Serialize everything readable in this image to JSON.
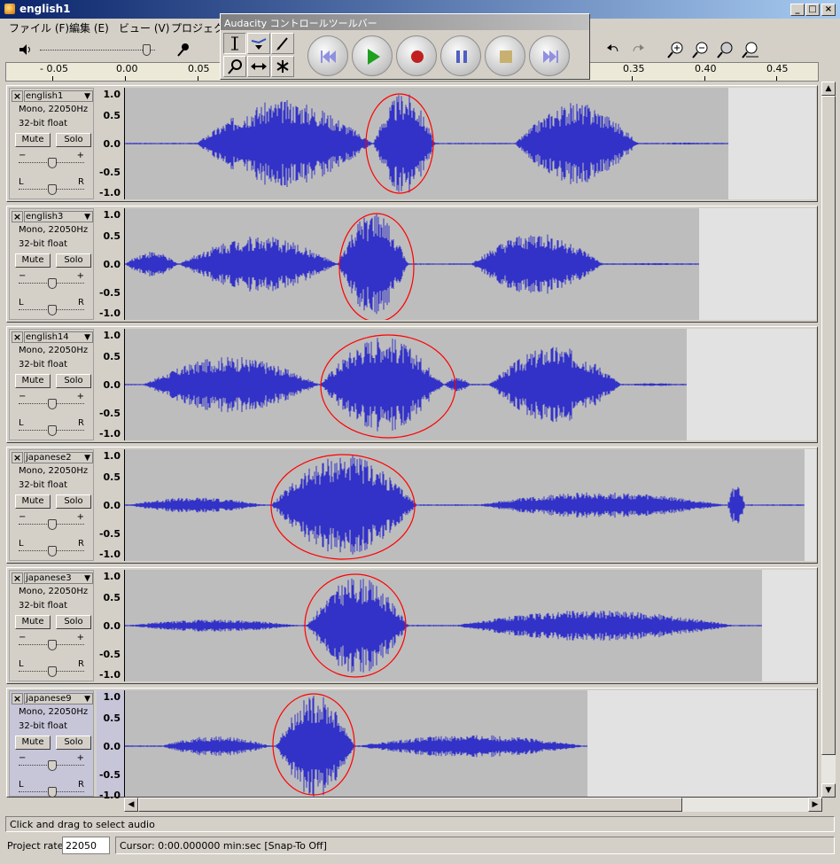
{
  "window": {
    "title": "english1"
  },
  "menu": {
    "items": [
      "ファイル (F)",
      "編集 (E)",
      "ビュー (V)",
      "プロジェクト"
    ]
  },
  "ruler": {
    "ticks": [
      "- 0.05",
      "0.00",
      "0.05",
      "0.35",
      "0.40",
      "0.45"
    ]
  },
  "control_toolbar": {
    "title": "Audacity コントロールツールバー"
  },
  "scale_labels": [
    "1.0",
    "0.5",
    "0.0",
    "-0.5",
    "-1.0"
  ],
  "mute_label": "Mute",
  "solo_label": "Solo",
  "slider_labels": {
    "minus": "−",
    "plus": "+",
    "left": "L",
    "right": "R"
  },
  "tracks": [
    {
      "name": "english1",
      "line1": "Mono, 22050Hz",
      "line2": "32-bit float",
      "selected": false
    },
    {
      "name": "english3",
      "line1": "Mono, 22050Hz",
      "line2": "32-bit float",
      "selected": false
    },
    {
      "name": "english14",
      "line1": "Mono, 22050Hz",
      "line2": "32-bit float",
      "selected": false
    },
    {
      "name": "japanese2",
      "line1": "Mono, 22050Hz",
      "line2": "32-bit float",
      "selected": false
    },
    {
      "name": "japanese3",
      "line1": "Mono, 22050Hz",
      "line2": "32-bit float",
      "selected": false
    },
    {
      "name": "japanese9",
      "line1": "Mono, 22050Hz",
      "line2": "32-bit float",
      "selected": true
    }
  ],
  "status": {
    "hint": "Click and drag to select audio",
    "project_rate_label": "Project rate:",
    "project_rate": "22050",
    "cursor": "Cursor: 0:00.000000 min:sec   [Snap-To Off]"
  },
  "colors": {
    "waveform": "#3232c8",
    "highlight": "#ff0000"
  }
}
